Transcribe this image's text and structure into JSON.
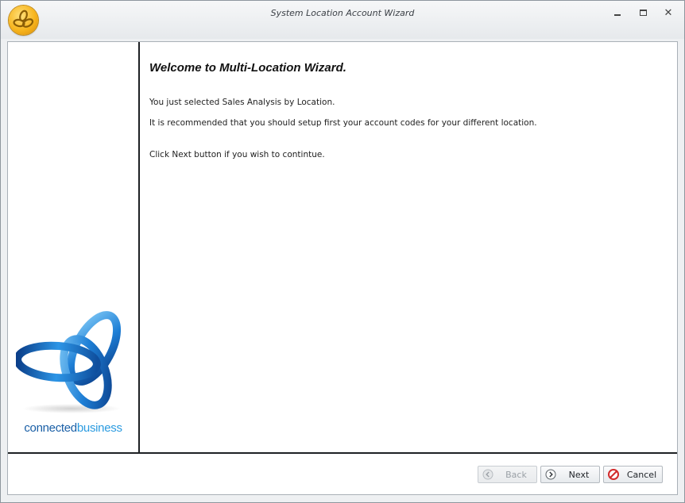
{
  "window": {
    "title": "System Location Account Wizard",
    "controls": {
      "minimize_icon": "minimize-icon",
      "restore_icon": "restore-icon",
      "close_icon": "close-icon"
    }
  },
  "sidebar": {
    "brand_part1": "connected",
    "brand_part2": "business"
  },
  "content": {
    "heading": "Welcome to Multi-Location Wizard.",
    "line1": "You just selected Sales Analysis by Location.",
    "line2": "It is recommended that you should setup first your account codes for your different location.",
    "line3": "Click Next button if you wish to contintue."
  },
  "footer": {
    "back_label": "Back",
    "next_label": "Next",
    "cancel_label": "Cancel",
    "back_enabled": false
  },
  "colors": {
    "brand_dark": "#1a5fa6",
    "brand_light": "#2b9be0",
    "orb": "#f7b51e",
    "cancel_icon": "#d22b2b"
  }
}
